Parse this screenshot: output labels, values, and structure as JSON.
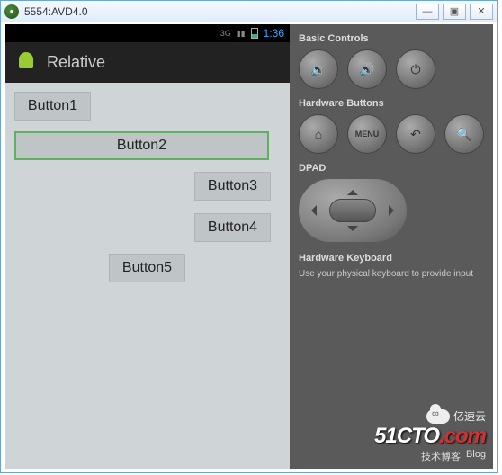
{
  "window": {
    "title": "5554:AVD4.0",
    "minimize_glyph": "—",
    "maximize_glyph": "▣",
    "close_glyph": "✕"
  },
  "device": {
    "statusbar": {
      "signal_label": "3G",
      "clock": "1:36"
    },
    "appbar": {
      "title": "Relative"
    },
    "buttons": {
      "b1": "Button1",
      "b2": "Button2",
      "b3": "Button3",
      "b4": "Button4",
      "b5": "Button5"
    }
  },
  "panel": {
    "basic_controls_heading": "Basic Controls",
    "vol_down_glyph": "🔉",
    "vol_up_glyph": "🔊",
    "power_glyph": "⏻",
    "hardware_buttons_heading": "Hardware Buttons",
    "home_glyph": "⌂",
    "menu_label": "MENU",
    "back_glyph": "↶",
    "search_glyph": "🔍",
    "dpad_heading": "DPAD",
    "hw_keyboard_heading": "Hardware Keyboard",
    "hw_keyboard_hint": "Use your physical keyboard to provide input"
  },
  "watermark": {
    "brand_main": "51CTO",
    "brand_suffix": ".com",
    "tagline_zh": "技术博客",
    "tagline_en": "Blog",
    "secondary": "亿速云"
  }
}
